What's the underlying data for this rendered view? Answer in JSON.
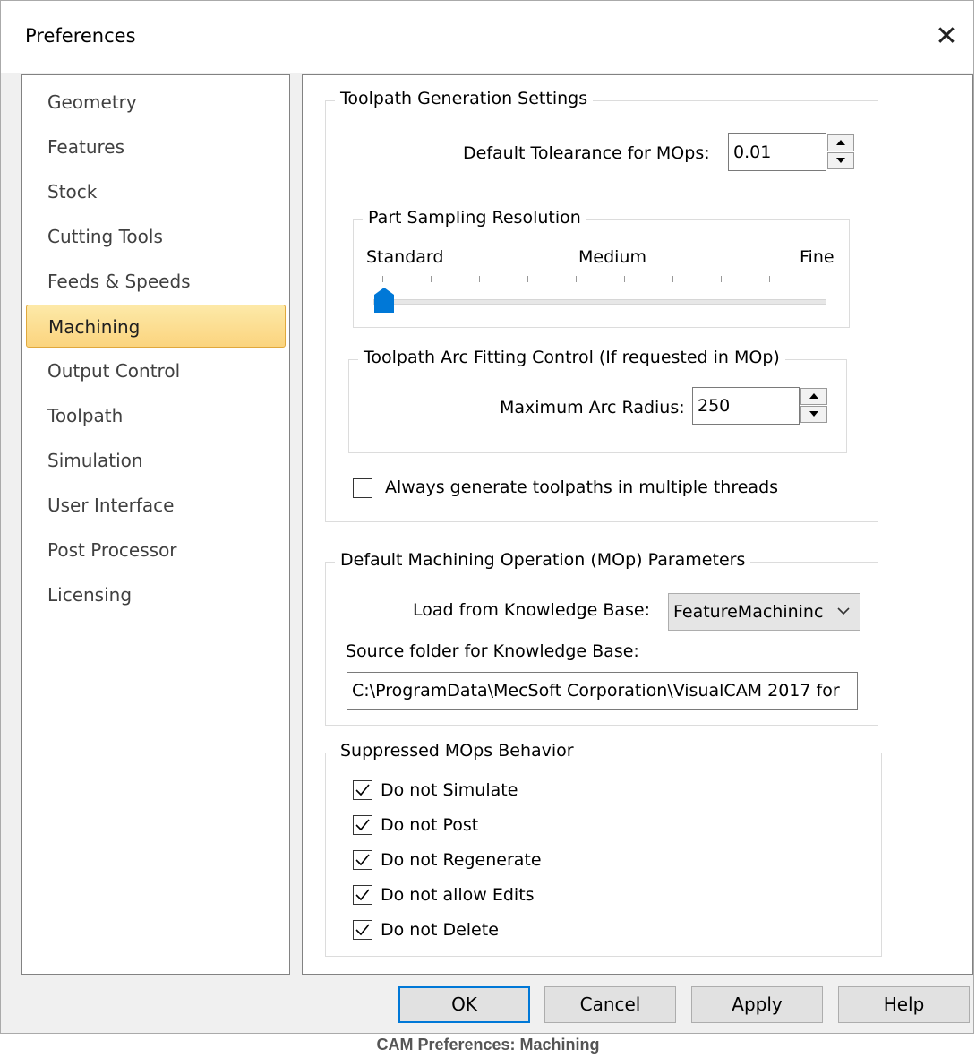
{
  "window": {
    "title": "Preferences"
  },
  "nav": {
    "items": [
      {
        "label": "Geometry"
      },
      {
        "label": "Features"
      },
      {
        "label": "Stock"
      },
      {
        "label": "Cutting Tools"
      },
      {
        "label": "Feeds & Speeds"
      },
      {
        "label": "Machining"
      },
      {
        "label": "Output Control"
      },
      {
        "label": "Toolpath"
      },
      {
        "label": "Simulation"
      },
      {
        "label": "User Interface"
      },
      {
        "label": "Post Processor"
      },
      {
        "label": "Licensing"
      }
    ],
    "selected": "Machining"
  },
  "toolpath_generation": {
    "legend": "Toolpath Generation Settings",
    "tolerance_label": "Default Tolearance for MOps:",
    "tolerance_value": "0.01",
    "sampling": {
      "legend": "Part Sampling Resolution",
      "label_left": "Standard",
      "label_mid": "Medium",
      "label_right": "Fine",
      "slider_fraction": 0.0
    },
    "arc_fitting": {
      "legend": "Toolpath Arc Fitting Control (If requested in MOp)",
      "radius_label": "Maximum Arc Radius:",
      "radius_value": "250"
    },
    "multithread": {
      "label": "Always generate toolpaths in multiple threads",
      "checked": false
    }
  },
  "mop_params": {
    "legend": "Default Machining Operation (MOp) Parameters",
    "kb_label": "Load from Knowledge Base:",
    "kb_value": "FeatureMachininc",
    "folder_label": "Source folder for Knowledge Base:",
    "folder_value": "C:\\ProgramData\\MecSoft Corporation\\VisualCAM 2017 for"
  },
  "suppressed": {
    "legend": "Suppressed MOps Behavior",
    "options": [
      {
        "label": "Do not Simulate",
        "checked": true
      },
      {
        "label": "Do not Post",
        "checked": true
      },
      {
        "label": "Do not Regenerate",
        "checked": true
      },
      {
        "label": "Do not allow Edits",
        "checked": true
      },
      {
        "label": "Do not Delete",
        "checked": true
      }
    ]
  },
  "buttons": {
    "ok": "OK",
    "cancel": "Cancel",
    "apply": "Apply",
    "help": "Help"
  },
  "caption": "CAM Preferences: Machining",
  "colors": {
    "accent": "#0078d7",
    "selection_bg": "#fbd47e",
    "selection_border": "#e0a83c"
  }
}
